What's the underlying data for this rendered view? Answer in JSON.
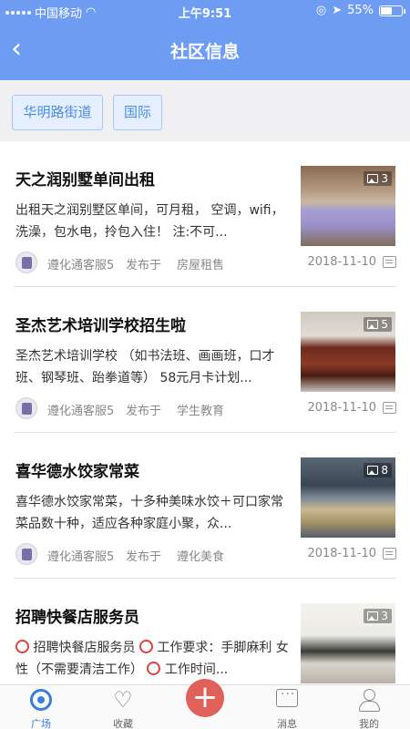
{
  "status_bar": {
    "carrier": "中国移动",
    "time": "上午9:51",
    "battery": "55%",
    "battery_level": 0.55
  },
  "header": {
    "title": "社区信息",
    "back_icon": "chevron-left-icon"
  },
  "tags": [
    {
      "label": "华明路街道"
    },
    {
      "label": "国际"
    }
  ],
  "posts": [
    {
      "title": "天之润别墅单间出租",
      "desc": "出租天之润别墅区单间，可月租， 空调，wifi，洗澡，包水电，拎包入住！ 注:不可...",
      "author": "遵化通客服5",
      "posted_label": "发布于",
      "category": "房屋租售",
      "date": "2018-11-10",
      "image_count": "3"
    },
    {
      "title": "圣杰艺术培训学校招生啦",
      "desc": "圣杰艺术培训学校 （如书法班、画画班，口才班、钢琴班、跆拳道等） 58元月卡计划...",
      "author": "遵化通客服5",
      "posted_label": "发布于",
      "category": "学生教育",
      "date": "2018-11-10",
      "image_count": "5"
    },
    {
      "title": "喜华德水饺家常菜",
      "desc": "喜华德水饺家常菜，十多种美味水饺＋可口家常菜品数十种，适应各种家庭小聚，众...",
      "author": "遵化通客服5",
      "posted_label": "发布于",
      "category": "遵化美食",
      "date": "2018-11-10",
      "image_count": "8"
    },
    {
      "title": "招聘快餐店服务员",
      "desc_part1": "招聘快餐店服务员",
      "desc_part2": "工作要求：手脚麻利 女性（不需要清洁工作）",
      "desc_part3": "工作时间...",
      "image_count": "3"
    }
  ],
  "tabbar": {
    "items": [
      {
        "label": "广场",
        "icon": "eye-icon"
      },
      {
        "label": "收藏",
        "icon": "heart-icon"
      },
      {
        "label": "",
        "icon": "plus-icon"
      },
      {
        "label": "消息",
        "icon": "message-icon"
      },
      {
        "label": "我的",
        "icon": "user-icon"
      }
    ]
  },
  "colors": {
    "header_bg": "#6e9cf2",
    "tag_text": "#4a8de0",
    "active_tab": "#3a7de0",
    "add_button": "#e0605a"
  }
}
